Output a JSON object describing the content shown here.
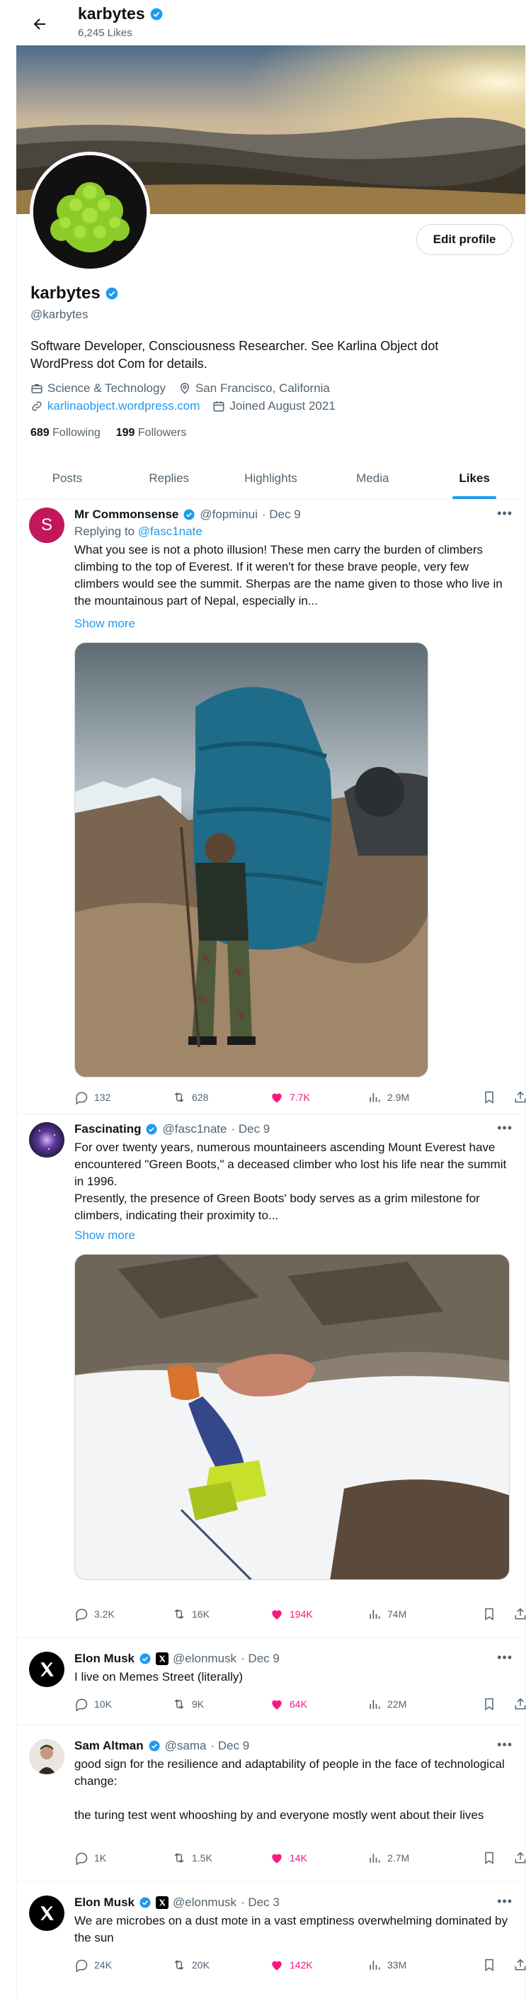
{
  "header": {
    "title": "karbytes",
    "likes_count": "6,245 Likes"
  },
  "profile": {
    "name": "karbytes",
    "handle": "@karbytes",
    "edit_label": "Edit profile",
    "bio": "Software Developer, Consciousness Researcher. See Karlina Object dot WordPress dot Com for details.",
    "category": "Science & Technology",
    "location": "San Francisco, California",
    "website": "karlinaobject.wordpress.com",
    "joined": "Joined August 2021",
    "following_count": "689",
    "following_label": "Following",
    "followers_count": "199",
    "followers_label": "Followers"
  },
  "tabs": [
    {
      "label": "Posts"
    },
    {
      "label": "Replies"
    },
    {
      "label": "Highlights"
    },
    {
      "label": "Media"
    },
    {
      "label": "Likes"
    }
  ],
  "active_tab": "Likes",
  "colors": {
    "accent": "#1d9bf0",
    "like": "#f91880",
    "verified": "#1d9bf0"
  },
  "tweets": [
    {
      "name": "Mr Commonsense",
      "handle": "@fopminui",
      "date": "· Dec 9",
      "avatar_letter": "S",
      "replying_prefix": "Replying to",
      "replying_to": "@fasc1nate",
      "text": "What you see is not a photo illusion! These men carry the burden of climbers climbing to the top of Everest. If it weren't for these brave people, very few climbers would see the summit. Sherpas are the name given to those who live in the mountainous part of Nepal, especially in...",
      "show_more": "Show more",
      "replies": "132",
      "reposts": "628",
      "likes": "7.7K",
      "views": "2.9M"
    },
    {
      "name": "Fascinating",
      "handle": "@fasc1nate",
      "date": "· Dec 9",
      "text_1": "For over twenty years, numerous mountaineers ascending Mount Everest have encountered \"Green Boots,\" a deceased climber who lost his life near the summit in 1996.",
      "text_2": "Presently, the presence of Green Boots' body serves as a grim milestone for climbers, indicating their proximity to...",
      "show_more": "Show more",
      "replies": "3.2K",
      "reposts": "16K",
      "likes": "194K",
      "views": "74M"
    },
    {
      "name": "Elon Musk",
      "handle": "@elonmusk",
      "date": "· Dec 9",
      "text": "I live on Memes Street (literally)",
      "replies": "10K",
      "reposts": "9K",
      "likes": "64K",
      "views": "22M"
    },
    {
      "name": "Sam Altman",
      "handle": "@sama",
      "date": "· Dec 9",
      "text_1": "good sign for the resilience and adaptability of people in the face of technological change:",
      "text_2": "the turing test went whooshing by and everyone mostly went about their lives",
      "replies": "1K",
      "reposts": "1.5K",
      "likes": "14K",
      "views": "2.7M"
    },
    {
      "name": "Elon Musk",
      "handle": "@elonmusk",
      "date": "· Dec 3",
      "text": "We are microbes on a dust mote in a vast emptiness overwhelming dominated by the sun",
      "replies": "24K",
      "reposts": "20K",
      "likes": "142K",
      "views": "33M"
    }
  ]
}
